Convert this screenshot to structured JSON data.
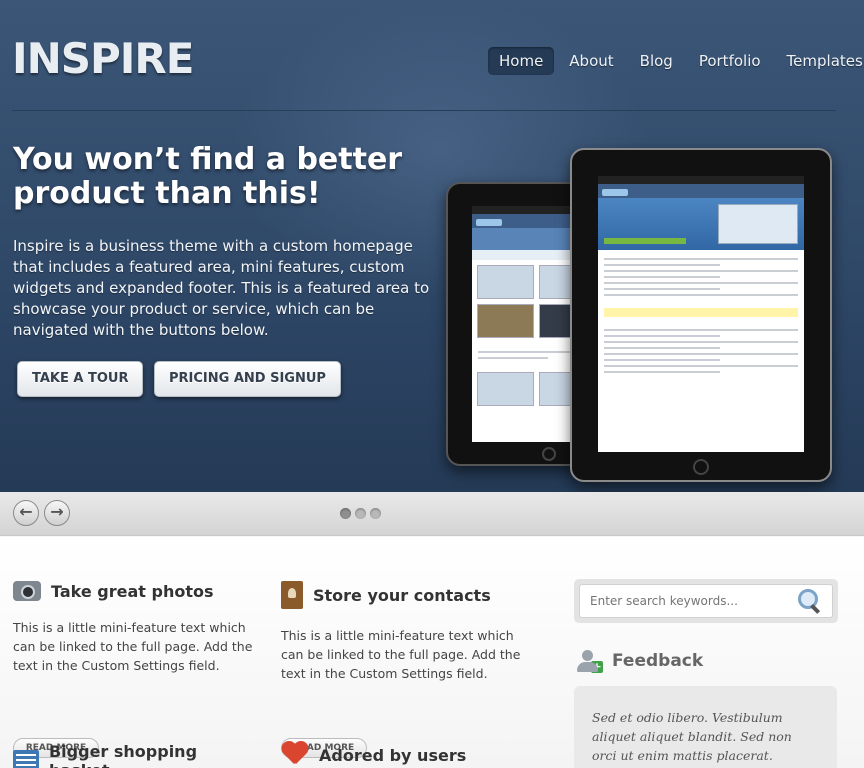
{
  "header": {
    "logo": "INSPIRE",
    "nav": [
      "Home",
      "About",
      "Blog",
      "Portfolio",
      "Templates"
    ]
  },
  "featured": {
    "title": "You won’t find a better product than this!",
    "text": "Inspire is a business theme with a custom homepage that includes a featured area, mini features, custom widgets and expanded footer. This is a featured area to showcase your product or service, which can be navigated with the buttons below.",
    "buttons": [
      "TAKE A TOUR",
      "PRICING AND SIGNUP"
    ],
    "slide_count": 3,
    "active_slide": 1
  },
  "slider": {
    "prev": "←",
    "next": "→"
  },
  "features": [
    {
      "title": "Take great photos",
      "icon": "camera-icon",
      "text": "This is a little mini-feature text which can be linked to the full page. Add the text in the Custom Settings field.",
      "button": "READ MORE"
    },
    {
      "title": "Store your contacts",
      "icon": "contacts-book-icon",
      "text": "This is a little mini-feature text which can be linked to the full page. Add the text in the Custom Settings field.",
      "button": "READ MORE"
    },
    {
      "title": "Bigger shopping basket",
      "icon": "shopping-basket-icon"
    },
    {
      "title": "Adored by users",
      "icon": "heart-icon"
    }
  ],
  "sidebar": {
    "search_placeholder": "Enter search keywords...",
    "feedback_title": "Feedback",
    "feedback_text": "Sed et odio libero. Vestibulum aliquet aliquet blandit. Sed non orci ut enim mattis placerat. Aenean ultrices"
  }
}
